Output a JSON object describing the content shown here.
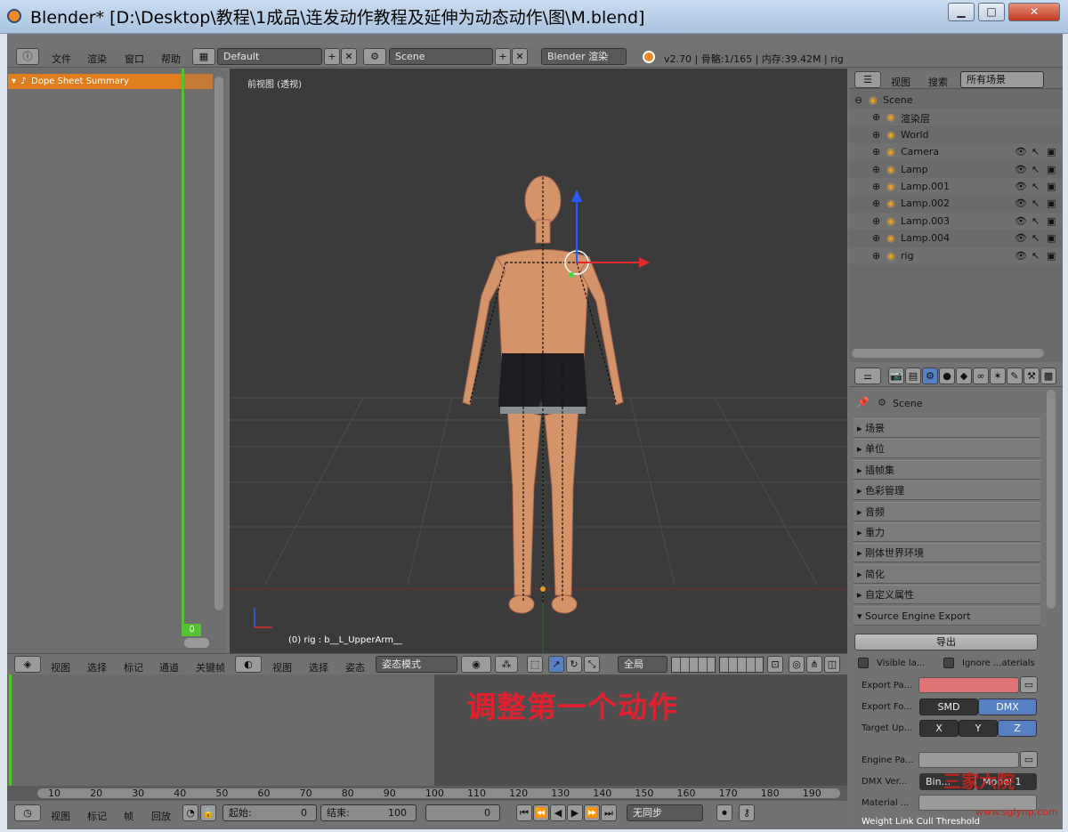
{
  "window": {
    "title": "Blender* [D:\\Desktop\\教程\\1成品\\连发动作教程及延伸为动态动作\\图\\M.blend]",
    "min": "▁",
    "max": "□",
    "close": "✕"
  },
  "menu": {
    "file": "文件",
    "render": "渲染",
    "window": "窗口",
    "help": "帮助"
  },
  "header": {
    "layout": "Default",
    "scene": "Scene",
    "engine": "Blender 渲染",
    "stats": "v2.70 | 骨骼:1/165 | 内存:39.42M | rig",
    "plus": "+",
    "x": "✕"
  },
  "dopesheet": {
    "summary": "Dope Sheet Summary",
    "frame": "0",
    "menu": [
      "视图",
      "选择",
      "标记",
      "通道",
      "关键帧"
    ]
  },
  "viewport": {
    "title": "前视图 (透视)",
    "status": "(0) rig : b__L_UpperArm__",
    "menu": [
      "视图",
      "选择",
      "姿态"
    ],
    "mode": "姿态模式",
    "orientation": "全局"
  },
  "outliner": {
    "menu": [
      "视图",
      "搜索"
    ],
    "filter": "所有场景",
    "items": [
      {
        "label": "Scene",
        "indent": 0
      },
      {
        "label": "渲染层",
        "indent": 1
      },
      {
        "label": "World",
        "indent": 1
      },
      {
        "label": "Camera",
        "indent": 1
      },
      {
        "label": "Lamp",
        "indent": 1
      },
      {
        "label": "Lamp.001",
        "indent": 1
      },
      {
        "label": "Lamp.002",
        "indent": 1
      },
      {
        "label": "Lamp.003",
        "indent": 1
      },
      {
        "label": "Lamp.004",
        "indent": 1
      },
      {
        "label": "rig",
        "indent": 1
      }
    ]
  },
  "properties": {
    "context": "Scene",
    "panels": [
      "场景",
      "单位",
      "插帧集",
      "色彩管理",
      "音频",
      "重力",
      "刚体世界环境",
      "简化",
      "自定义属性"
    ],
    "source": {
      "title": "Source Engine Export",
      "export_btn": "导出",
      "visible": "Visible la...",
      "ignore": "Ignore ...aterials",
      "export_path": "Export Pa...",
      "export_format": "Export Fo...",
      "smd": "SMD",
      "dmx": "DMX",
      "target_up": "Target Up...",
      "x": "X",
      "y": "Y",
      "z": "Z",
      "engine_path": "Engine Pa...",
      "dmx_version": "DMX Ver...",
      "binary": "Bin...",
      "model": "Model 1",
      "material": "Material ...",
      "weight_link": "Weight Link Cull Threshold"
    }
  },
  "timeline": {
    "caption": "调整第一个动作",
    "ticks": [
      "10",
      "20",
      "30",
      "40",
      "50",
      "60",
      "70",
      "80",
      "90",
      "100",
      "110",
      "120",
      "130",
      "140",
      "150",
      "160",
      "170",
      "180",
      "190"
    ],
    "menu": [
      "视图",
      "标记",
      "帧",
      "回放"
    ],
    "start_label": "起始:",
    "start": "0",
    "end_label": "结束:",
    "end": "100",
    "current": "0",
    "sync": "无同步"
  },
  "watermark": {
    "text": "三家六院",
    "url": "www.sglynp.com"
  },
  "colors": {
    "accent": "#e07e1e",
    "frame": "#52c42f",
    "caption": "#e0202c",
    "selected": "#5680c2"
  }
}
